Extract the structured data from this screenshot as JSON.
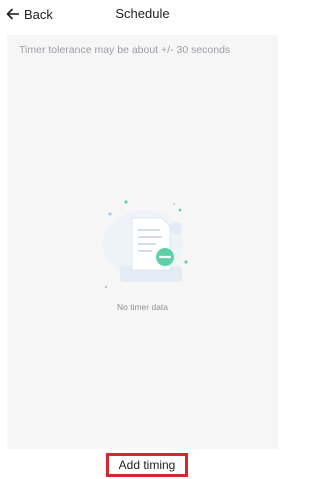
{
  "header": {
    "back_label": "Back",
    "title": "Schedule"
  },
  "notice": {
    "text": "Timer tolerance may be about +/- 30 seconds"
  },
  "empty_state": {
    "icon": "empty-document-icon",
    "text": "No timer data"
  },
  "footer": {
    "add_label": "Add timing"
  },
  "colors": {
    "accent": "#5ed1a9",
    "highlight_border": "#d9262c",
    "content_bg": "#f6f6f7"
  }
}
